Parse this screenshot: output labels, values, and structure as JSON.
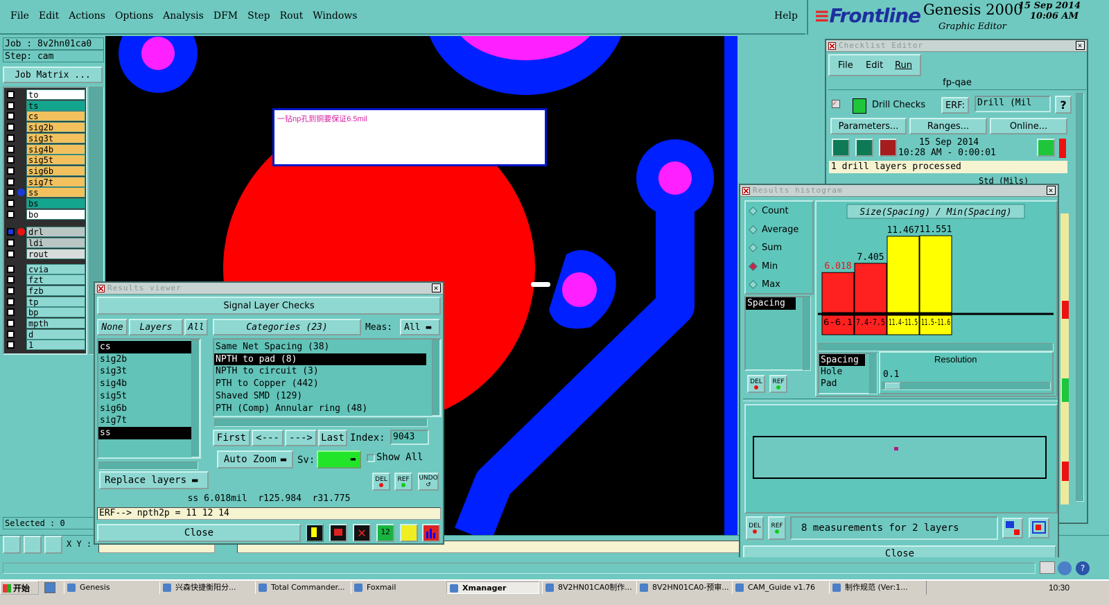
{
  "menubar": {
    "items": [
      "File",
      "Edit",
      "Actions",
      "Options",
      "Analysis",
      "DFM",
      "Step",
      "Rout",
      "Windows"
    ],
    "help": "Help"
  },
  "brand": {
    "logo": "Frontline",
    "product": "Genesis 2000",
    "subtitle": "Graphic Editor",
    "date": "15 Sep 2014",
    "time": "10:06 AM"
  },
  "job_panel": {
    "job": "Job : 8v2hn01ca0",
    "step": "Step: cam",
    "matrix_button": "Job Matrix ...",
    "selected": "Selected : 0",
    "coord_label": "X Y :"
  },
  "layers": [
    {
      "name": "to",
      "color": "#ffffff"
    },
    {
      "name": "ts",
      "color": "#14a58e"
    },
    {
      "name": "cs",
      "color": "#f2c15e"
    },
    {
      "name": "sig2b",
      "color": "#f2c15e"
    },
    {
      "name": "sig3t",
      "color": "#f2c15e"
    },
    {
      "name": "sig4b",
      "color": "#f2c15e"
    },
    {
      "name": "sig5t",
      "color": "#f2c15e"
    },
    {
      "name": "sig6b",
      "color": "#f2c15e"
    },
    {
      "name": "sig7t",
      "color": "#f2c15e"
    },
    {
      "name": "ss",
      "color": "#f2c15e"
    },
    {
      "name": "bs",
      "color": "#14a58e"
    },
    {
      "name": "bo",
      "color": "#ffffff"
    },
    {
      "name": "drl",
      "color": "#b9c6c4"
    },
    {
      "name": "ldi",
      "color": "#b9c6c4"
    },
    {
      "name": "rout",
      "color": "#d8dddc"
    },
    {
      "name": "cvia",
      "color": "#8fd8d2"
    },
    {
      "name": "fzt",
      "color": "#8fd8d2"
    },
    {
      "name": "fzb",
      "color": "#8fd8d2"
    },
    {
      "name": "tp",
      "color": "#8fd8d2"
    },
    {
      "name": "bp",
      "color": "#8fd8d2"
    },
    {
      "name": "mpth",
      "color": "#8fd8d2"
    },
    {
      "name": "d",
      "color": "#8fd8d2"
    },
    {
      "name": "1",
      "color": "#8fd8d2"
    }
  ],
  "canvas": {
    "note": "一钻np孔到铜要保证6.5mil"
  },
  "results_viewer": {
    "title": "Results viewer",
    "header": "Signal Layer Checks",
    "none_btn": "None",
    "layers_btn": "Layers",
    "all_btn": "All",
    "categories_btn": "Categories (23)",
    "meas_label": "Meas:",
    "meas_value": "All",
    "layer_list": [
      "cs",
      "sig2b",
      "sig3t",
      "sig4b",
      "sig5t",
      "sig6b",
      "sig7t",
      "ss"
    ],
    "categories": [
      "Same Net Spacing (38)",
      "NPTH to pad (8)",
      "NPTH to circuit (3)",
      "PTH to Copper (442)",
      "Shaved SMD (129)",
      "PTH (Comp) Annular ring (48)"
    ],
    "first": "First",
    "prev": "<---",
    "next": "--->",
    "last": "Last",
    "index_label": "Index:",
    "index_value": "9043",
    "auto_zoom": "Auto Zoom",
    "sv_label": "Sv:",
    "show_all": "Show All",
    "replace_layers": "Replace layers",
    "del": "DEL",
    "ref": "REF",
    "undo": "UNDO",
    "status": "ss 6.018mil  r125.984  r31.775",
    "erf": "ERF--> npth2p = 11 12 14",
    "close": "Close"
  },
  "checklist_editor": {
    "title": "Checklist Editor",
    "menu": [
      "File",
      "Edit",
      "Run"
    ],
    "name": "fp-qae",
    "check_name": "Drill Checks",
    "erf_label": "ERF:",
    "erf_value": "Drill (Mil",
    "help": "?",
    "parameters": "Parameters...",
    "ranges": "Ranges...",
    "online": "Online...",
    "date": "15 Sep 2014",
    "time_range": "10:28 AM - 0:00:01",
    "processed": "1 drill layers processed",
    "second_erf": "Std (Mils)"
  },
  "histogram": {
    "title": "Results histogram",
    "modes": [
      "Count",
      "Average",
      "Sum",
      "Min",
      "Max"
    ],
    "selected_mode": "Min",
    "measure": "Spacing",
    "measure_list": [
      "Spacing",
      "Hole",
      "Pad"
    ],
    "resolution_label": "Resolution",
    "resolution_value": "0.1",
    "summary": "8 measurements for 2 layers",
    "close": "Close",
    "del": "DEL",
    "ref": "REF"
  },
  "chart_data": {
    "type": "bar",
    "title": "Size(Spacing) / Min(Spacing)",
    "categories": [
      "6-6.1",
      "7.4-7.5",
      "11.4-11.5",
      "11.5-11.6"
    ],
    "values": [
      6.018,
      7.405,
      11.467,
      11.551
    ],
    "value_labels": [
      "6.018",
      "7.405",
      "11.467",
      "11.551"
    ],
    "colors": [
      "#ff2020",
      "#ff2020",
      "#ffff00",
      "#ffff00"
    ],
    "ylim": [
      0,
      12.5
    ],
    "grid": false
  },
  "taskbar": {
    "start": "开始",
    "items": [
      "Genesis",
      "兴森快捷衡阳分...",
      "Total Commander...",
      "Foxmail",
      "Xmanager",
      "8V2HN01CA0制作...",
      "8V2HN01CA0-预审...",
      "CAM_Guide v1.76",
      "制作规范 (Ver:1..."
    ],
    "clock": "10:30"
  },
  "colors": {
    "bg": "#6fc9c0",
    "pcb_black": "#000000",
    "copper_blue": "#0020ff",
    "pad_magenta": "#ff20ff",
    "red_pad": "#ff0000"
  }
}
